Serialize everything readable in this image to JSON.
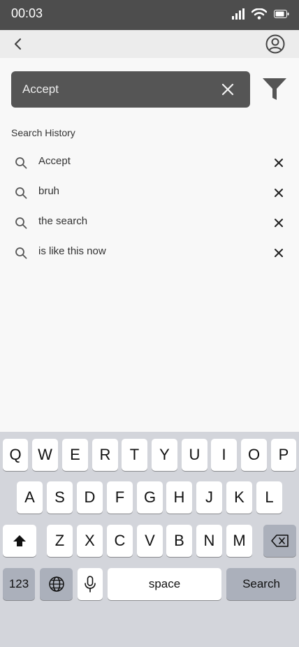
{
  "status_bar": {
    "time": "00:03"
  },
  "search": {
    "value": "Accept"
  },
  "history": {
    "title": "Search History",
    "items": [
      {
        "label": "Accept"
      },
      {
        "label": "bruh"
      },
      {
        "label": "the search"
      },
      {
        "label": "is like this now"
      }
    ]
  },
  "keyboard": {
    "row1": [
      "Q",
      "W",
      "E",
      "R",
      "T",
      "Y",
      "U",
      "I",
      "O",
      "P"
    ],
    "row2": [
      "A",
      "S",
      "D",
      "F",
      "G",
      "H",
      "J",
      "K",
      "L"
    ],
    "row3": [
      "Z",
      "X",
      "C",
      "V",
      "B",
      "N",
      "M"
    ],
    "numbers_label": "123",
    "space_label": "space",
    "search_label": "Search"
  },
  "icons": {
    "signal": "signal-icon",
    "wifi": "wifi-icon",
    "battery": "battery-icon",
    "back": "chevron-left-icon",
    "profile": "user-circle-icon",
    "clear": "close-icon",
    "filter": "filter-icon",
    "history_search": "search-icon",
    "history_remove": "close-icon",
    "shift": "shift-icon",
    "backspace": "backspace-icon",
    "globe": "globe-icon",
    "mic": "microphone-icon"
  },
  "colors": {
    "status_bar": "#4d4d4d",
    "nav_bar": "#ececec",
    "search_box": "#555555",
    "keyboard_bg": "#d3d5db",
    "key_dark": "#abb0bb"
  }
}
